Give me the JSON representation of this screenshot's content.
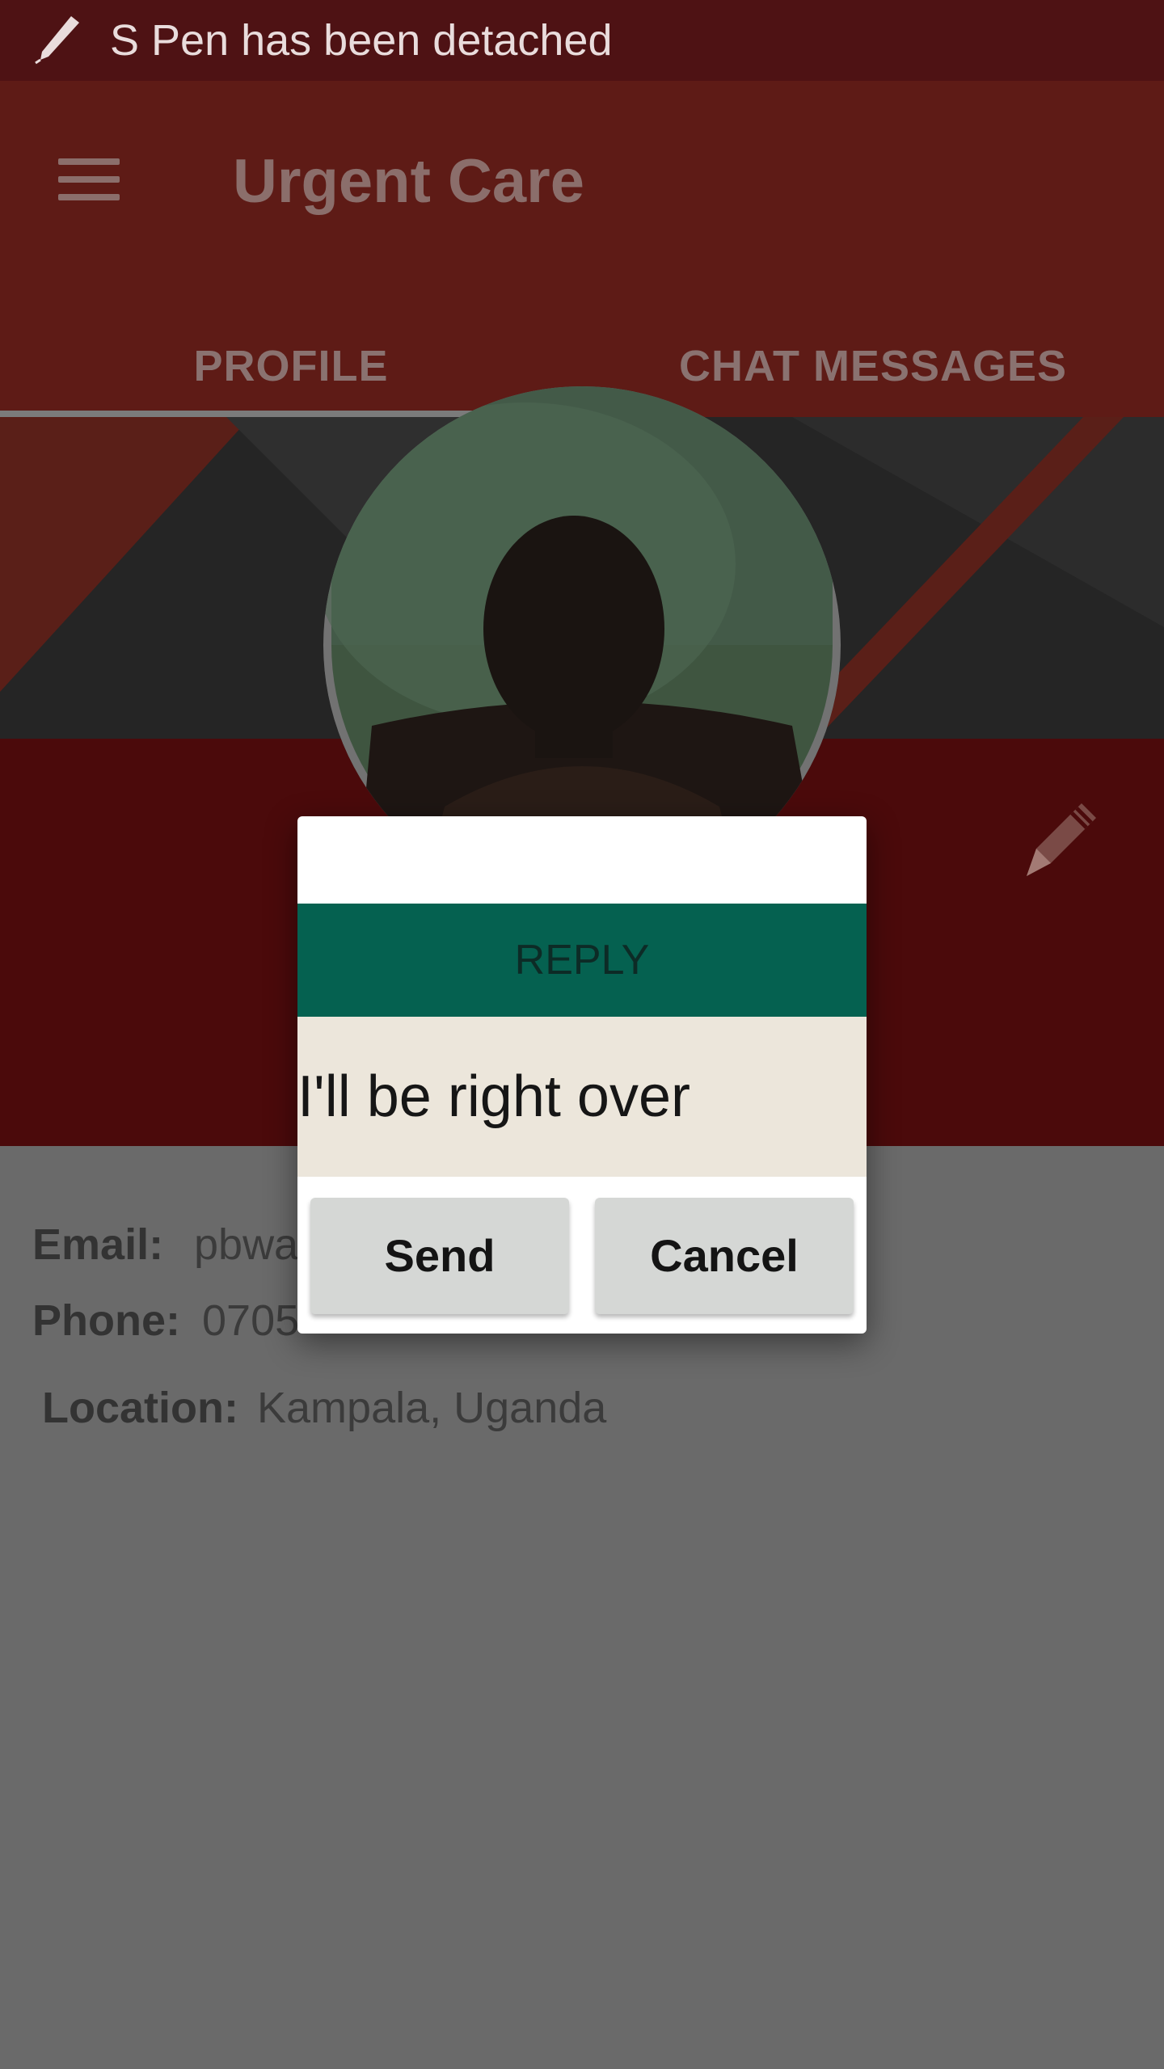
{
  "status_bar": {
    "message": "S Pen has been detached",
    "icon": "pen-icon"
  },
  "app_bar": {
    "title": "Urgent Care",
    "menu_icon": "hamburger-menu-icon"
  },
  "tabs": [
    {
      "label": "PROFILE",
      "selected": true
    },
    {
      "label": "CHAT MESSAGES",
      "selected": false
    }
  ],
  "profile": {
    "email_label": "Email:",
    "email_value": "pbwa",
    "phone_label": "Phone:",
    "phone_value": "0705",
    "location_label": "Location:",
    "location_value": "Kampala, Uganda",
    "edit_icon": "pencil-icon"
  },
  "dialog": {
    "header": "REPLY",
    "message": "I'll be right over",
    "send_label": "Send",
    "cancel_label": "Cancel"
  },
  "colors": {
    "status_bar": "#4e1214",
    "app_bar": "#5e1b16",
    "dialog_header": "#056150",
    "dialog_message_bg": "#ece6db",
    "scrim_content": "#6a6a6a"
  }
}
